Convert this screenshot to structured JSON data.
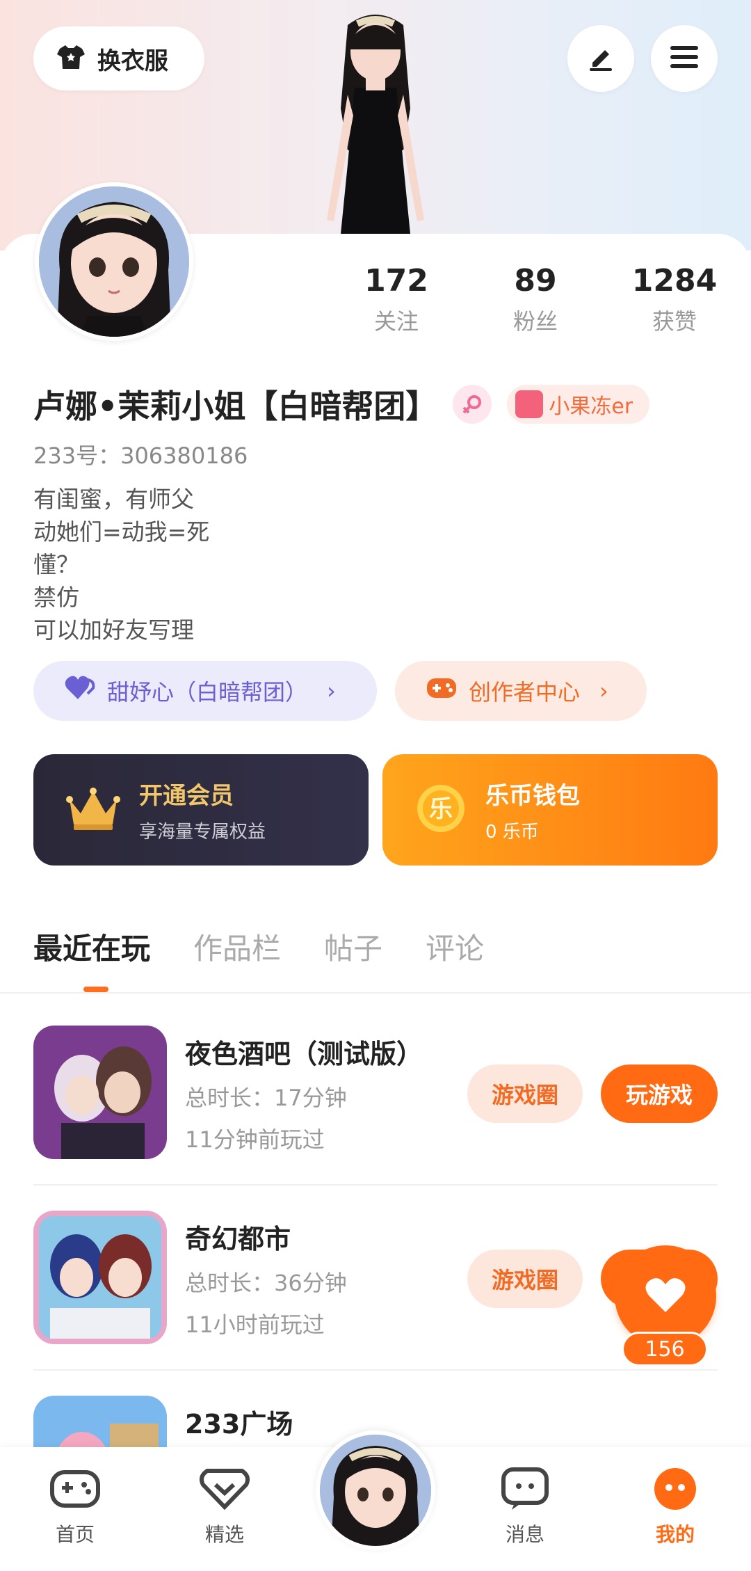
{
  "header": {
    "outfit_label": "换衣服",
    "edit_icon": "pen-icon",
    "menu_icon": "hamburger-icon"
  },
  "stats": [
    {
      "value": "172",
      "label": "关注"
    },
    {
      "value": "89",
      "label": "粉丝"
    },
    {
      "value": "1284",
      "label": "获赞"
    }
  ],
  "profile": {
    "name": "卢娜•茉莉小姐【白暗帮团】",
    "gender_icon": "female-icon",
    "tag": "小果冻er",
    "uid": "233号：306380186",
    "bio": [
      "有闺蜜，有师父",
      "动她们=动我=死",
      "懂？",
      "禁仿",
      "可以加好友写理"
    ]
  },
  "pills": {
    "group": "甜妤心（白暗帮团）",
    "creator": "创作者中心"
  },
  "cards": {
    "member": {
      "title": "开通会员",
      "sub": "享海量专属权益"
    },
    "wallet": {
      "title": "乐币钱包",
      "sub": "0 乐币"
    }
  },
  "tabs": [
    "最近在玩",
    "作品栏",
    "帖子",
    "评论"
  ],
  "games": [
    {
      "title": "夜色酒吧（测试版）",
      "duration": "总时长：17分钟",
      "last": "11分钟前玩过",
      "circle": "游戏圈",
      "play": "玩游戏"
    },
    {
      "title": "奇幻都市",
      "duration": "总时长：36分钟",
      "last": "11小时前玩过",
      "circle": "游戏圈",
      "play": "玩游戏"
    },
    {
      "title": "233广场",
      "duration": "",
      "last": "",
      "circle": "",
      "play": ""
    }
  ],
  "float_like": {
    "count": "156"
  },
  "nav": [
    "首页",
    "精选",
    "消息",
    "我的"
  ],
  "colors": {
    "accent": "#ff6a13",
    "member_bg": "#2a2838",
    "group_text": "#6a5fd3"
  }
}
